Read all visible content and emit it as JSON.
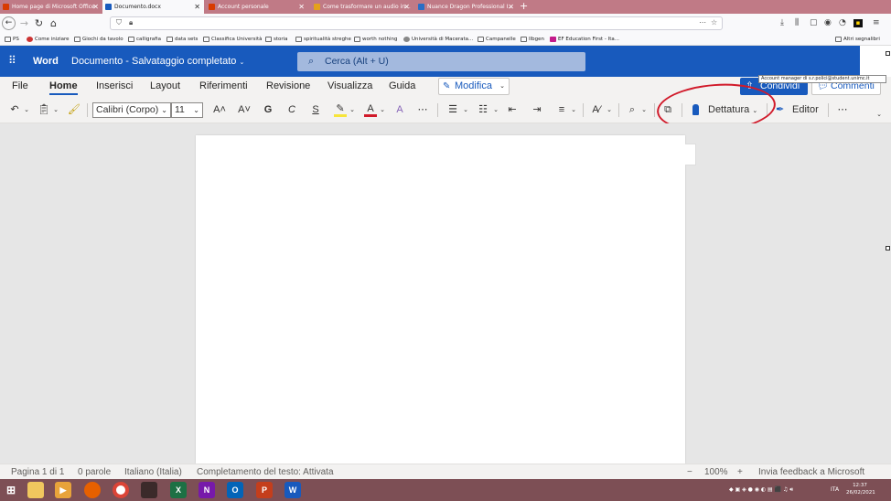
{
  "browser": {
    "tabs": [
      {
        "title": "Home page di Microsoft Office",
        "icon": "office-icon",
        "color": "#d83b01"
      },
      {
        "title": "Documento.docx",
        "icon": "word-icon",
        "color": "#185abd"
      },
      {
        "title": "Account personale",
        "icon": "office-icon",
        "color": "#d83b01"
      },
      {
        "title": "Come trasformare un audio in...",
        "icon": "page-icon",
        "color": "#e4a11b"
      },
      {
        "title": "Nuance Dragon Professional I...",
        "icon": "page-icon",
        "color": "#2a6ec6"
      }
    ],
    "new_tab": "+",
    "bookmarks": [
      "PS",
      "Come iniziare",
      "Giochi da tavolo",
      "calligrafia",
      "data sets",
      "Classifica Università",
      "storia",
      "spiritualità streghe",
      "worth nothing",
      "Università di Macerata...",
      "Campanelle",
      "Ilbgen",
      "EF Education First - Ita..."
    ],
    "other_bookmarks": "Altri segnalibri"
  },
  "word": {
    "app_name": "Word",
    "doc_title": "Documento - Salvataggio completato",
    "search_placeholder": "Cerca (Alt + U)",
    "tooltip": "Account manager di s.r.polici@student.unimc.it",
    "menu": [
      "File",
      "Home",
      "Inserisci",
      "Layout",
      "Riferimenti",
      "Revisione",
      "Visualizza",
      "Guida"
    ],
    "active_menu": "Home",
    "modifica": "Modifica",
    "share": "Condividi",
    "comments": "Commenti",
    "font_name": "Calibri (Corpo)",
    "font_size": "11",
    "ribbon_glyphs": {
      "grow": "A˄",
      "shrink": "A˅",
      "bold": "G",
      "italic": "C",
      "underline": "S",
      "highlight": "✎",
      "fontcolor": "A",
      "clear": "A",
      "more": "⋯",
      "overflow": "⋯"
    },
    "dictate": "Dettatura",
    "editor": "Editor",
    "highlight_color": "#f7e53a",
    "font_color": "#d11a2a"
  },
  "status": {
    "page": "Pagina 1 di 1",
    "words": "0 parole",
    "language": "Italiano (Italia)",
    "completion": "Completamento del testo: Attivata",
    "zoom_minus": "−",
    "zoom": "100%",
    "zoom_plus": "+",
    "feedback": "Invia feedback a Microsoft"
  },
  "taskbar": {
    "lang": "ITA",
    "time": "12:37",
    "date": "26/02/2021"
  }
}
